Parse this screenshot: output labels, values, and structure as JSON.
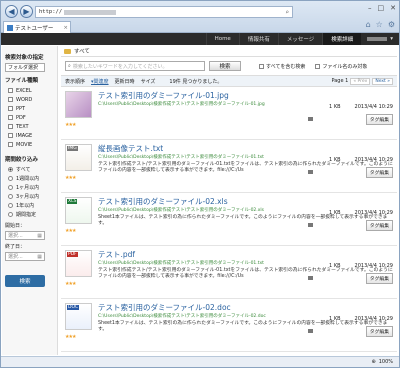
{
  "browser": {
    "address": "http://",
    "tab_title": "テストユーザー",
    "zoom": "100%"
  },
  "topnav": {
    "items": [
      "Home",
      "情報共有",
      "メッセージ",
      "検索詳細"
    ],
    "active": 3
  },
  "breadcrumb": "すべて",
  "sidebar": {
    "scope_title": "検索対象の指定",
    "folder_select": "フォルダ選択",
    "filetype_title": "ファイル種類",
    "filetypes": [
      "EXCEL",
      "WORD",
      "PPT",
      "PDF",
      "TEXT",
      "IMAGE",
      "MOVIE"
    ],
    "period_title": "期間絞り込み",
    "periods": [
      "すべて",
      "1週間以内",
      "1ヶ月以内",
      "3ヶ月以内",
      "1年以内",
      "期間指定"
    ],
    "start_label": "開始日：",
    "end_label": "終了日：",
    "date_placeholder": "選択...",
    "search_button": "検索"
  },
  "search": {
    "placeholder": "検索したいキワードを入力してください。",
    "button": "検索",
    "option_all": "すべてを含む検索",
    "option_filename": "ファイル名のみ対象"
  },
  "sortbar": {
    "label": "表示順序",
    "sorts": [
      "関連度",
      "更新日時",
      "サイズ"
    ],
    "count": "19件 見つかりました。",
    "page": "Page 1",
    "prev": "« Prev",
    "next": "Next »"
  },
  "results": [
    {
      "title": "テスト索引用のダミーファイル-01.jpg",
      "path": "C:\\Users\\Public\\Desktop\\検索作成テスト\\テスト索引用のダミーファイル-01.jpg",
      "snippet": "",
      "size": "1 KB",
      "date": "2013/4/4 10:29",
      "tag_button": "タグ編集",
      "stars": "★★★"
    },
    {
      "title": "縦長画像テスト.txt",
      "path": "C:\\Users\\Public\\Desktop\\検索作成テスト\\テスト索引用のダミーファイル-01.txt",
      "snippet": "テスト索引作成テスト/テスト索引用のダミーファイル-01.txtをファイルは、テスト索引の為に作られたダミーファイルです。このようにファイルの内容を一部抜粋して表示する事ができます。file:///C:/Us",
      "size": "1 KB",
      "date": "2013/4/4 10:29",
      "tag_button": "タグ編集",
      "stars": "★★★"
    },
    {
      "title": "テスト索引用のダミーファイル-02.xls",
      "path": "C:\\Users\\Public\\Desktop\\検索作成テスト\\テスト索引用のダミーファイル-02.xls",
      "snippet": "Sheet1本ファイルは、テスト索引の為に作られたダミーファイルです。このようにファイルの内容を一部抜粋して表示する事ができます。",
      "size": "1 KB",
      "date": "2013/4/4 10:29",
      "tag_button": "タグ編集",
      "stars": "★★★"
    },
    {
      "title": "テスト.pdf",
      "path": "C:\\Users\\Public\\Desktop\\検索作成テスト\\テスト索引用のダミーファイル-01.txt",
      "snippet": "テスト索引作成テスト/テスト索引用のダミーファイル-01.txtをファイルは、テスト索引の為に作られたダミーファイルです。このようにファイルの内容を一部抜粋して表示する事ができます。file:///C:/Us",
      "size": "1 KB",
      "date": "2013/4/4 10:29",
      "tag_button": "タグ編集",
      "stars": "★★★"
    },
    {
      "title": "テスト索引用のダミーファイル-02.doc",
      "path": "C:\\Users\\Public\\Desktop\\検索作成テスト\\テスト索引用のダミーファイル-02.doc",
      "snippet": "Sheet1本ファイルは、テスト索引の為に作られたダミーファイルです。このようにファイルの内容を一部抜粋して表示する事ができます。",
      "size": "1 KB",
      "date": "2013/4/4 10:29",
      "tag_button": "タグ編集",
      "stars": "★★★"
    }
  ]
}
